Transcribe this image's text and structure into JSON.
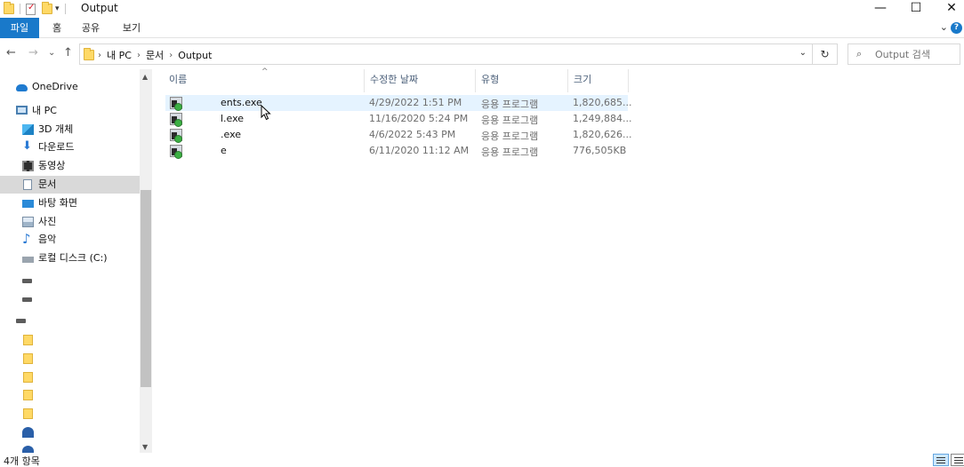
{
  "window": {
    "title": "Output",
    "controls": {
      "minimize": "—",
      "maximize": "☐",
      "close": "✕"
    }
  },
  "ribbon": {
    "tabs": [
      "파일",
      "홈",
      "공유",
      "보기"
    ],
    "collapse": "⌄",
    "help": "?"
  },
  "nav": {
    "back": "←",
    "forward": "→",
    "recent": "⌄",
    "up": "↑",
    "refresh": "↻"
  },
  "address": {
    "crumbs": [
      "내 PC",
      "문서",
      "Output"
    ],
    "separator": "›",
    "dropdown": "⌄"
  },
  "search": {
    "placeholder": "Output 검색",
    "icon": "⌕"
  },
  "sidebar": {
    "items": [
      {
        "label": "OneDrive",
        "icon": "cloud-icon"
      },
      {
        "label": "내 PC",
        "icon": "pc-icon"
      },
      {
        "label": "3D 개체",
        "icon": "cube-icon"
      },
      {
        "label": "다운로드",
        "icon": "download-icon"
      },
      {
        "label": "동영상",
        "icon": "video-icon"
      },
      {
        "label": "문서",
        "icon": "document-icon",
        "selected": true
      },
      {
        "label": "바탕 화면",
        "icon": "desktop-icon"
      },
      {
        "label": "사진",
        "icon": "pictures-icon"
      },
      {
        "label": "음악",
        "icon": "music-icon"
      },
      {
        "label": "로컬 디스크 (C:)",
        "icon": "disk-icon"
      }
    ]
  },
  "columns": {
    "name": "이름",
    "date": "수정한 날짜",
    "type": "유형",
    "size": "크기",
    "sort_indicator": "^"
  },
  "files": [
    {
      "name": "ents.exe",
      "date": "4/29/2022 1:51 PM",
      "type": "응용 프로그램",
      "size": "1,820,685..."
    },
    {
      "name": "l.exe",
      "date": "11/16/2020 5:24 PM",
      "type": "응용 프로그램",
      "size": "1,249,884..."
    },
    {
      "name": ".exe",
      "date": "4/6/2022 5:43 PM",
      "type": "응용 프로그램",
      "size": "1,820,626..."
    },
    {
      "name": "e",
      "date": "6/11/2020 11:12 AM",
      "type": "응용 프로그램",
      "size": "776,505KB"
    }
  ],
  "status": {
    "count": "4개 항목"
  }
}
